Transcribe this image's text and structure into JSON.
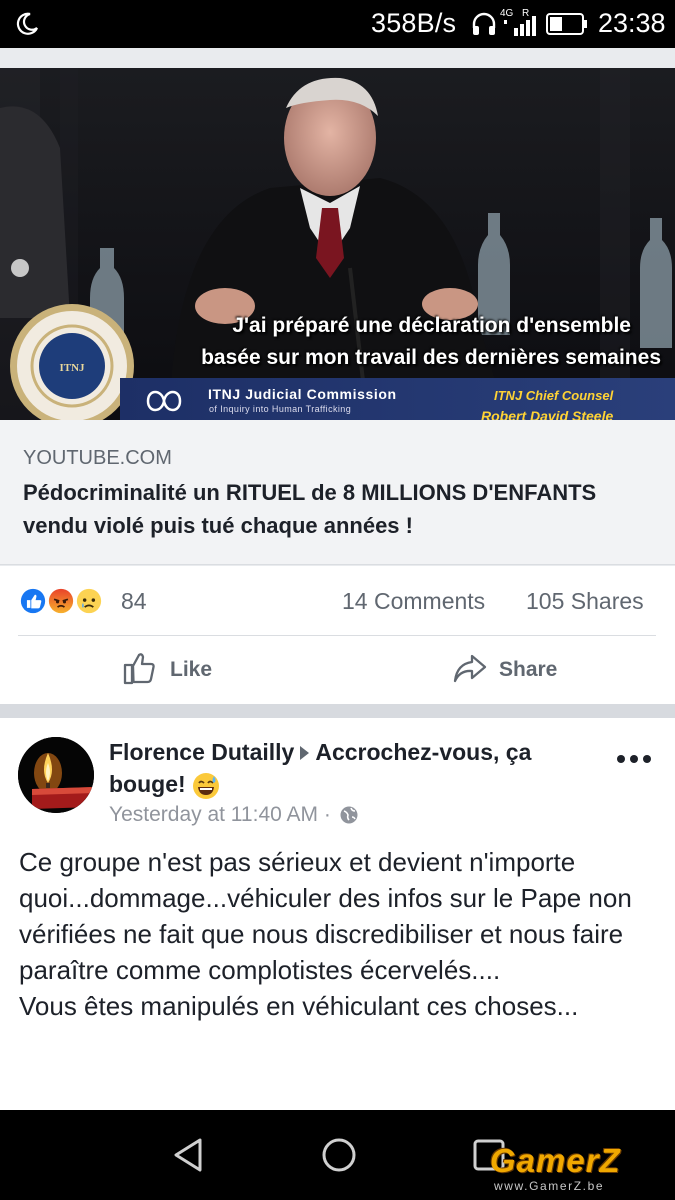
{
  "status_bar": {
    "net_speed": "358B/s",
    "network_type": "4G",
    "roaming": "R",
    "time": "23:38",
    "icons": [
      "moon-icon",
      "headset-icon",
      "signal-icon",
      "battery-icon"
    ]
  },
  "link_preview": {
    "video_caption_line1": "J'ai préparé une déclaration d'ensemble",
    "video_caption_line2": "basée sur mon travail des dernières semaines",
    "lower_third_left": "ITNJ Judicial Commission",
    "lower_third_left_sub": "of Inquiry into Human Trafficking",
    "lower_third_right": "ITNJ Chief Counsel",
    "lower_third_right_sub": "Robert David Steele",
    "seal_text": "ITNJ",
    "domain": "YOUTUBE.COM",
    "title": "Pédocriminalité un RITUEL de 8 MILLIONS D'ENFANTS vendu violé puis tué chaque années !"
  },
  "engagement": {
    "reaction_icons": [
      "like-reaction-icon",
      "angry-reaction-icon",
      "sad-reaction-icon"
    ],
    "reaction_count": "84",
    "comments": "14 Comments",
    "shares": "105 Shares"
  },
  "actions": {
    "like_label": "Like",
    "share_label": "Share"
  },
  "post": {
    "author": "Florence Dutailly",
    "group": "Accrochez-vous, ça bouge!",
    "timestamp": "Yesterday at 11:40 AM",
    "separator": "·",
    "text": "Ce groupe n'est pas sérieux et devient n'importe quoi...dommage...véhiculer des infos sur le Pape non vérifiées ne fait que nous discredibiliser et nous faire paraître comme complotistes écervelés....\nVous êtes manipulés en véhiculant ces choses..."
  },
  "nav_bar": {
    "buttons": [
      "back-button",
      "home-button",
      "recents-button"
    ]
  },
  "watermark": {
    "brand": "GamerZ",
    "url": "www.GamerZ.be"
  },
  "colors": {
    "status_bar": "#000000",
    "background": "#e9ebee",
    "card_meta": "#f2f3f5",
    "text_primary": "#1d2129",
    "text_secondary": "#606770",
    "like_blue": "#1877f2",
    "angry_orange": "#f05a28",
    "sad_yellow": "#fcd353",
    "watermark_orange": "#f0a800"
  }
}
